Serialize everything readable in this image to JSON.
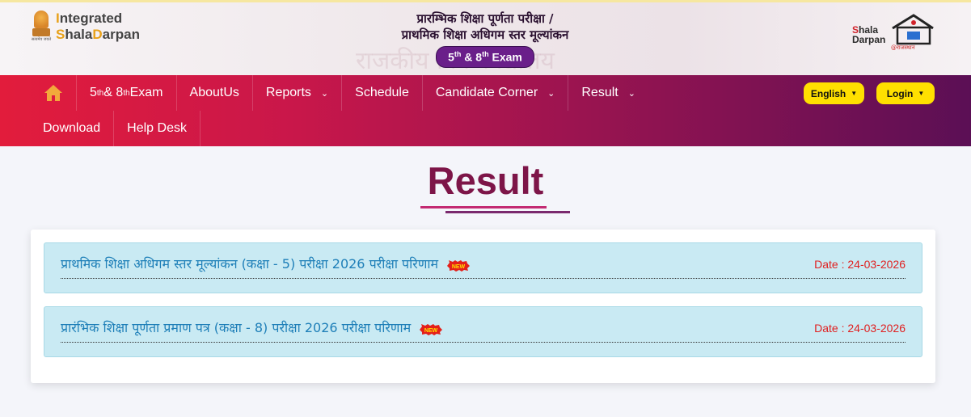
{
  "header": {
    "brand_line1": "Integrated",
    "brand_line2": "ShalaDarpan",
    "emblem_caption": "सत्यमेव जयते",
    "title_line1": "प्रारम्भिक शिक्षा पूर्णता परीक्षा /",
    "title_line2": "प्राथमिक शिक्षा अधिगम स्तर मूल्यांकन",
    "exam_pill": {
      "a": "5",
      "b": "th",
      "c": " & 8",
      "d": "th",
      "e": " Exam"
    },
    "right_logo_line1": "Shala",
    "right_logo_line2": "Darpan",
    "right_logo_sub": "@राजस्थान",
    "background_text": "राजकीय  विक  विद्यालय"
  },
  "nav": {
    "items_row1": [
      {
        "label": "home",
        "icon": "home-icon"
      },
      {
        "label": "5",
        "sup1": "th",
        "mid": " & 8",
        "sup2": "th",
        "tail": " Exam"
      },
      {
        "label": "AboutUs"
      },
      {
        "label": "Reports",
        "dropdown": true
      },
      {
        "label": "Schedule"
      },
      {
        "label": "Candidate Corner",
        "dropdown": true
      },
      {
        "label": "Result",
        "dropdown": true
      }
    ],
    "items_row2": [
      {
        "label": "Download"
      },
      {
        "label": "Help Desk"
      }
    ],
    "language_button": "English",
    "login_button": "Login"
  },
  "colors": {
    "nav_start": "#e21c3c",
    "nav_end": "#5b0f55",
    "pill_yellow": "#ffe000",
    "title_color": "#7d1548",
    "link_color": "#1e7fb8",
    "date_color": "#e02020",
    "item_bg": "#c9eaf3"
  },
  "main": {
    "page_title": "Result",
    "results": [
      {
        "title": "प्राथमिक शिक्षा अधिगम स्तर मूल्यांकन (कक्षा - 5) परीक्षा 2026 परीक्षा परिणाम",
        "badge": "NEW",
        "date": "Date : 24-03-2026"
      },
      {
        "title": "प्रारंभिक शिक्षा पूर्णता प्रमाण पत्र (कक्षा - 8) परीक्षा 2026 परीक्षा परिणाम",
        "badge": "NEW",
        "date": "Date : 24-03-2026"
      }
    ]
  }
}
